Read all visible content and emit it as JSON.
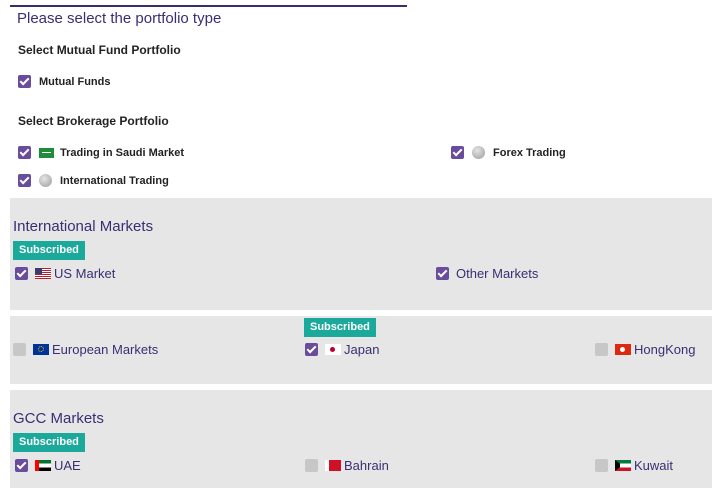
{
  "header": {
    "title": "Please select the portfolio type"
  },
  "mutual_fund": {
    "section_title": "Select Mutual Fund Portfolio",
    "items": [
      {
        "label": "Mutual Funds",
        "checked": true
      }
    ]
  },
  "brokerage": {
    "section_title": "Select Brokerage Portfolio",
    "items": [
      {
        "label": "Trading in Saudi Market",
        "checked": true,
        "icon": "saudi-flag-icon"
      },
      {
        "label": "Forex Trading",
        "checked": true,
        "icon": "globe-icon"
      },
      {
        "label": "International Trading",
        "checked": true,
        "icon": "globe-icon"
      }
    ]
  },
  "international": {
    "title": "International Markets",
    "badge": "Subscribed",
    "markets": [
      {
        "label": "US Market",
        "checked": true,
        "flag": "us-flag-icon",
        "subscribed": true
      },
      {
        "label": "Other Markets",
        "checked": true
      }
    ]
  },
  "other_markets": {
    "badge": "Subscribed",
    "markets": [
      {
        "label": "European Markets",
        "checked": false,
        "flag": "eu-flag-icon"
      },
      {
        "label": "Japan",
        "checked": true,
        "flag": "japan-flag-icon",
        "subscribed": true
      },
      {
        "label": "HongKong",
        "checked": false,
        "flag": "hongkong-flag-icon"
      }
    ]
  },
  "gcc": {
    "title": "GCC Markets",
    "badge": "Subscribed",
    "markets": [
      {
        "label": "UAE",
        "checked": true,
        "flag": "uae-flag-icon",
        "subscribed": true
      },
      {
        "label": "Bahrain",
        "checked": false,
        "flag": "bahrain-flag-icon"
      },
      {
        "label": "Kuwait",
        "checked": false,
        "flag": "kuwait-flag-icon"
      }
    ]
  },
  "colors": {
    "accent": "#6a4c9c",
    "heading": "#3b2e72",
    "badge": "#1aa99a",
    "panel": "#e6e6e6",
    "unchecked": "#c7c7c7"
  }
}
